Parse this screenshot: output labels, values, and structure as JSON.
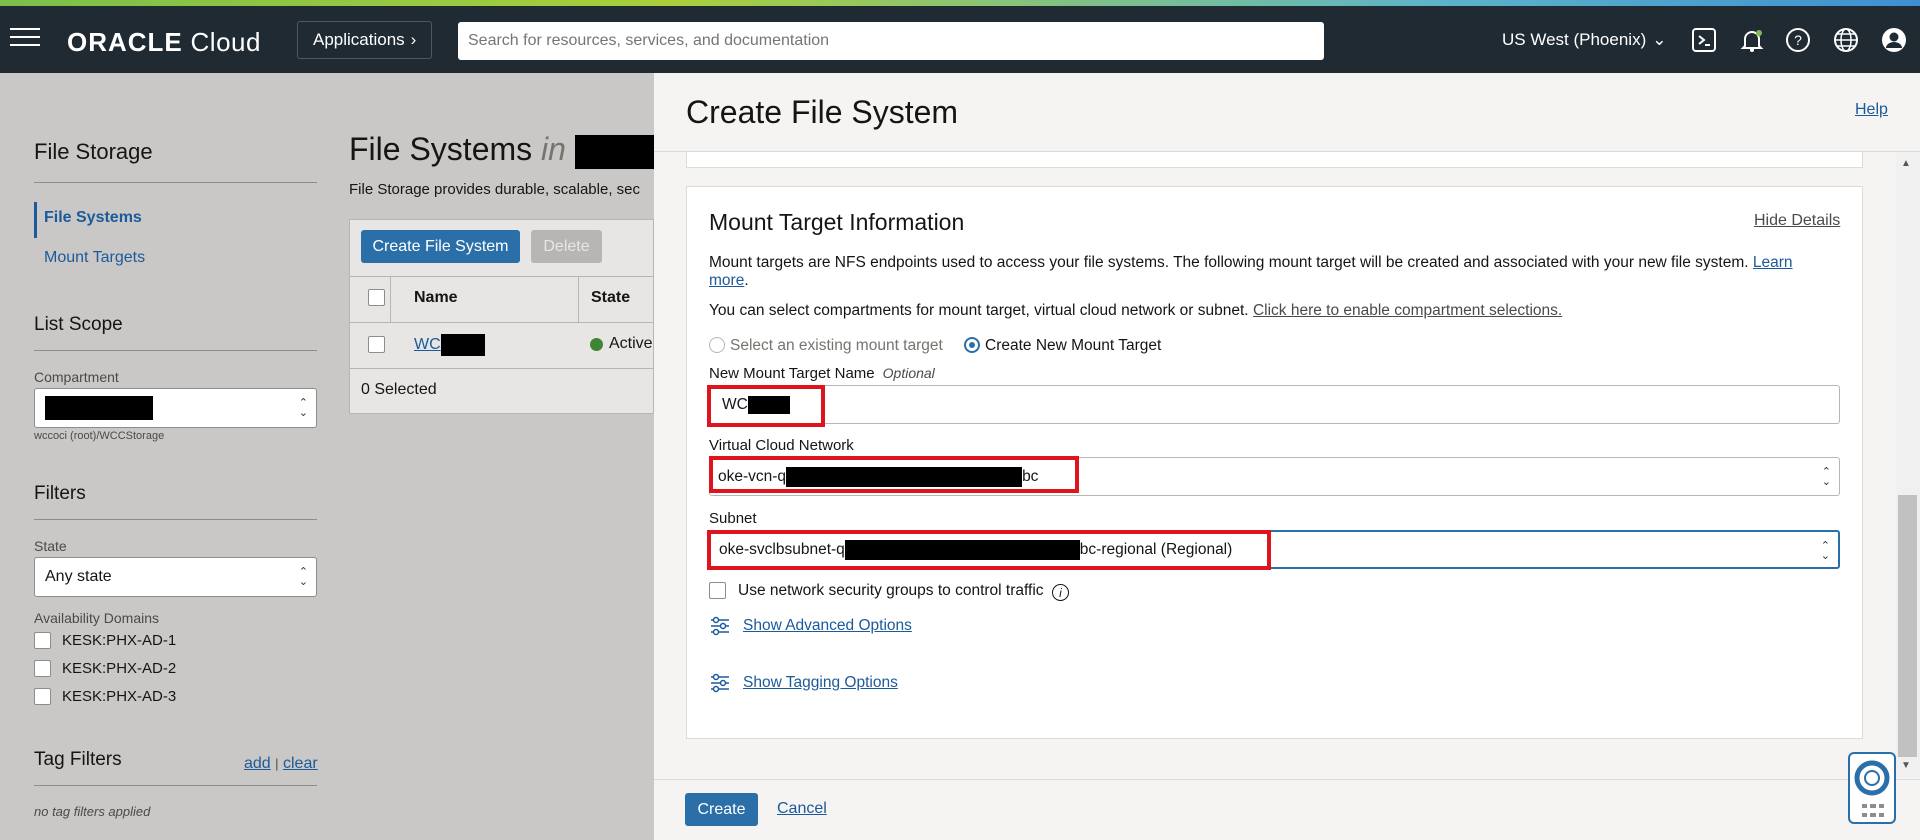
{
  "topbar": {
    "logo_brand": "ORACLE",
    "logo_product": "Cloud",
    "applications_label": "Applications",
    "search_placeholder": "Search for resources, services, and documentation",
    "region_label": "US West (Phoenix)"
  },
  "sidebar": {
    "title": "File Storage",
    "nav": [
      "File Systems",
      "Mount Targets"
    ],
    "list_scope_title": "List Scope",
    "compartment_label": "Compartment",
    "compartment_path": "wccoci (root)/WCCStorage",
    "filters_title": "Filters",
    "state_label": "State",
    "state_value": "Any state",
    "availability_domains_label": "Availability Domains",
    "availability_domains": [
      "KESK:PHX-AD-1",
      "KESK:PHX-AD-2",
      "KESK:PHX-AD-3"
    ],
    "tag_filters_title": "Tag Filters",
    "tag_add": "add",
    "tag_separator": "|",
    "tag_clear": "clear",
    "no_tag_filters": "no tag filters applied"
  },
  "main": {
    "title": "File Systems",
    "title_in": "in",
    "description": "File Storage provides durable, scalable, sec",
    "create_button": "Create File System",
    "delete_button": "Delete",
    "columns": [
      "Name",
      "State"
    ],
    "rows": [
      {
        "name": "WC",
        "state": "Active"
      }
    ],
    "selected_count": "0 Selected"
  },
  "panel": {
    "title": "Create File System",
    "help_link": "Help",
    "section_title": "Mount Target Information",
    "hide_details": "Hide Details",
    "info_text": "Mount targets are NFS endpoints used to access your file systems. The following mount target will be created and associated with your new file system.",
    "learn": "Learn",
    "more": "more",
    "compartment_text": "You can select compartments for mount target, virtual cloud network or subnet.",
    "compartment_link": "Click here to enable compartment selections.",
    "radio_existing": "Select an existing mount target",
    "radio_new": "Create New Mount Target",
    "mount_name_label": "New Mount Target Name",
    "optional": "Optional",
    "mount_name_value": "WC",
    "vcn_label": "Virtual Cloud Network",
    "vcn_prefix": "oke-vcn-q",
    "vcn_suffix": "bc",
    "subnet_label": "Subnet",
    "subnet_prefix": "oke-svclbsubnet-q",
    "subnet_suffix": "bc-regional (Regional)",
    "nsg_label": "Use network security groups to control traffic",
    "advanced_options": "Show Advanced Options",
    "tagging_options": "Show Tagging Options",
    "create_button": "Create",
    "cancel_link": "Cancel"
  },
  "colors": {
    "topbar_bg": "#1f2a33",
    "link": "#1c5a9b",
    "primary_button": "#2b6fa9",
    "highlight_red": "#e0141f",
    "status_active": "#3e8635"
  }
}
